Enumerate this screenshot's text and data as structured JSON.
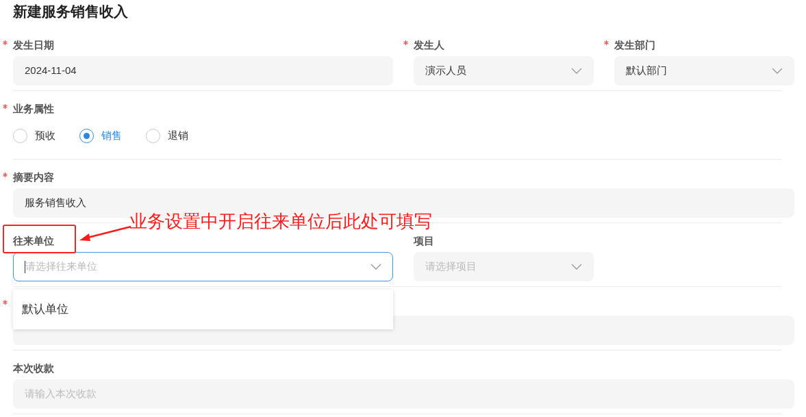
{
  "title": "新建服务销售收入",
  "rows": [
    {
      "fields": [
        {
          "kind": "input",
          "label": "发生日期",
          "required": true,
          "value": "2024-11-04"
        },
        {
          "kind": "select",
          "label": "发生人",
          "required": true,
          "value": "演示人员"
        },
        {
          "kind": "select",
          "label": "发生部门",
          "required": true,
          "value": "默认部门"
        }
      ]
    },
    {
      "fields": [
        {
          "kind": "radio",
          "label": "业务属性",
          "required": true,
          "options": [
            {
              "label": "预收",
              "selected": false
            },
            {
              "label": "销售",
              "selected": true
            },
            {
              "label": "退销",
              "selected": false
            }
          ]
        }
      ]
    },
    {
      "fields": [
        {
          "kind": "input",
          "label": "摘要内容",
          "required": true,
          "value": "服务销售收入"
        }
      ]
    },
    {
      "fields": [
        {
          "kind": "select",
          "label": "往来单位",
          "required": false,
          "placeholder": "请选择往来单位",
          "focused": true,
          "highlighted": true,
          "dropdown": [
            "默认单位"
          ]
        },
        {
          "kind": "select",
          "label": "项目",
          "required": false,
          "placeholder": "请选择项目"
        }
      ]
    },
    {
      "fields": [
        {
          "kind": "input",
          "required": true
        }
      ]
    },
    {
      "fields": [
        {
          "kind": "input",
          "label": "本次收款",
          "required": false,
          "placeholder": "请输入本次收款"
        }
      ]
    }
  ],
  "annotation": {
    "text": "业务设置中开启往来单位后此处可填写"
  }
}
